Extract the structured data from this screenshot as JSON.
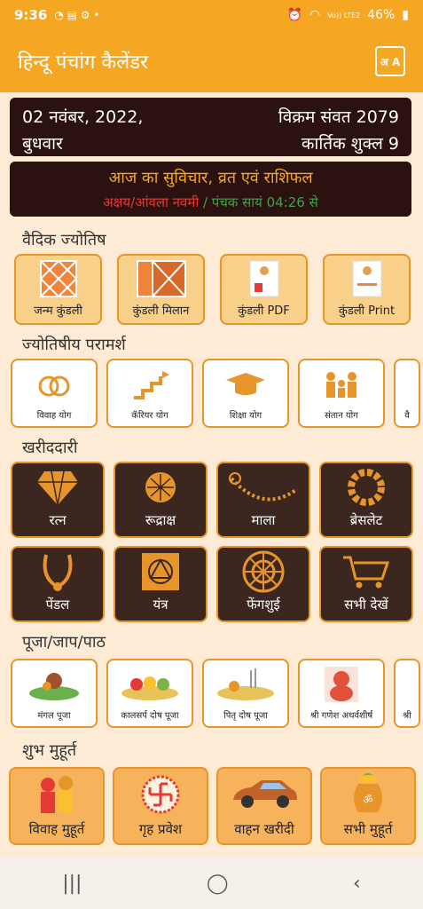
{
  "status": {
    "time": "9:36",
    "battery": "46%",
    "network": "Vo)) LTE2"
  },
  "app": {
    "title": "हिन्दू पंचांग कैलेंडर",
    "lang_icon": "अ A"
  },
  "date_card": {
    "date": "02 नवंबर, 2022,",
    "day": "बुधवार",
    "samvat": "विक्रम संवत 2079",
    "tithi": "कार्तिक शुक्ल 9"
  },
  "vichar": {
    "heading": "आज का सुविचार, व्रत एवं राशिफल",
    "festival": "अक्षय/आंवला नवमी",
    "separator": " / ",
    "panchak": "पंचक सायं 04:26 से"
  },
  "sections": {
    "vedic": {
      "title": "वैदिक ज्योतिष",
      "items": [
        "जन्म कुंडली",
        "कुंडली मिलान",
        "कुंडली PDF",
        "कुंडली Print"
      ]
    },
    "paramarsh": {
      "title": "ज्योतिषीय परामर्श",
      "items": [
        "विवाह योग",
        "कॅरियर योग",
        "शिक्षा योग",
        "संतान योग",
        "वै"
      ]
    },
    "kharidari": {
      "title": "खरीददारी",
      "row1": [
        "रत्न",
        "रूद्राक्ष",
        "माला",
        "ब्रेसलेट"
      ],
      "row2": [
        "पेंडल",
        "यंत्र",
        "फेंगशुई",
        "सभी देखें"
      ]
    },
    "puja": {
      "title": "पूजा/जाप/पाठ",
      "items": [
        "मंगल पूजा",
        "कालसर्प दोष पूजा",
        "पितृ दोष पूजा",
        "श्री गणेश अथर्वशीर्ष",
        "श्री"
      ]
    },
    "muhurt": {
      "title": "शुभ मुहूर्त",
      "items": [
        "विवाह मुहूर्त",
        "गृह प्रवेश",
        "वाहन खरीदी",
        "सभी मुहूर्त"
      ]
    }
  },
  "colors": {
    "primary": "#f5a623",
    "dark_card": "#2b1210",
    "background": "#fdebd5"
  }
}
